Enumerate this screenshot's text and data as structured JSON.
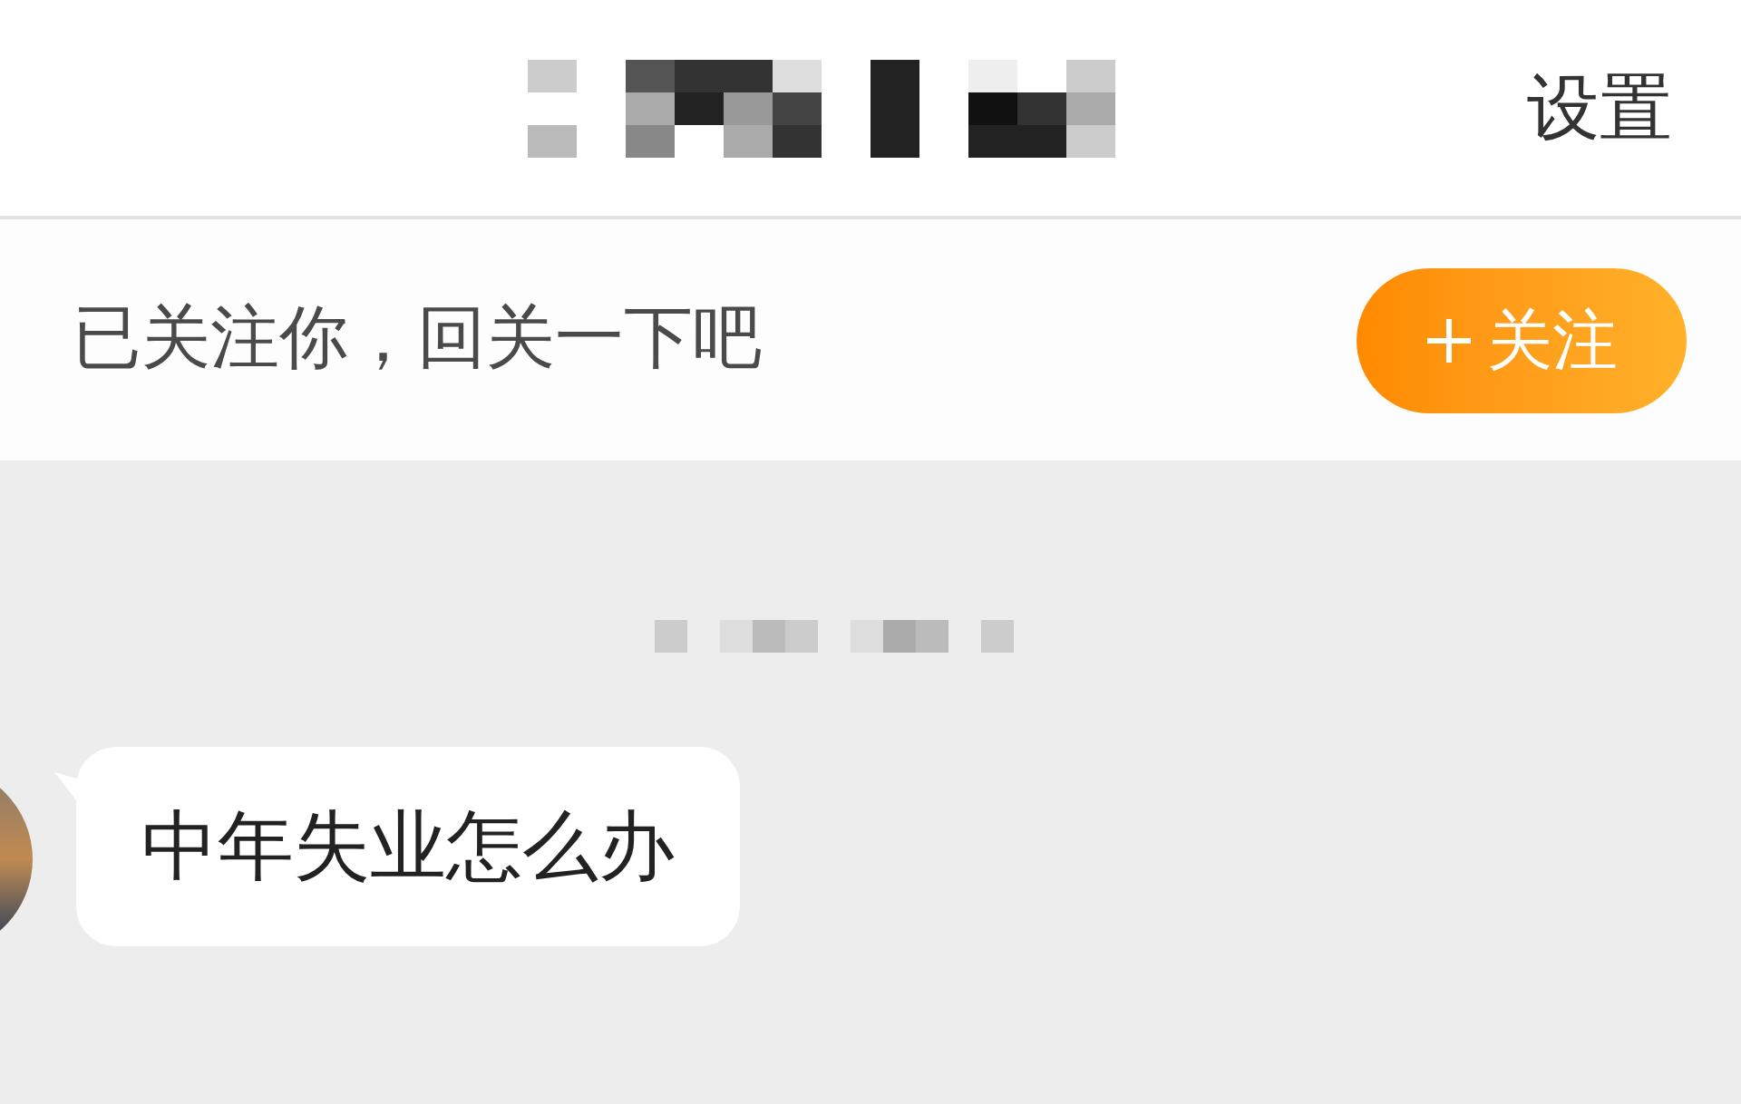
{
  "header": {
    "settings": "设置"
  },
  "follow_bar": {
    "message": "已关注你，回关一下吧",
    "button": "关注"
  },
  "messages": [
    {
      "text": "中年失业怎么办"
    }
  ]
}
